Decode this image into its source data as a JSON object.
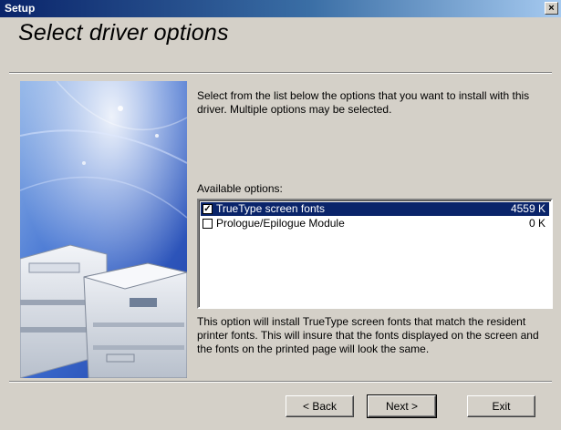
{
  "window": {
    "title": "Setup",
    "close_glyph": "×"
  },
  "page": {
    "heading": "Select driver options",
    "description": "Select from the list below the options that you want to install with this driver. Multiple options may be selected."
  },
  "options": {
    "label": "Available options:",
    "items": [
      {
        "name": "TrueType screen fonts",
        "size": "4559 K",
        "checked": true,
        "selected": true
      },
      {
        "name": "Prologue/Epilogue Module",
        "size": "0 K",
        "checked": false,
        "selected": false
      }
    ],
    "info": "This option will install TrueType screen fonts that match the resident printer fonts. This will insure that the fonts displayed on the screen and the fonts on the printed page will look the same."
  },
  "buttons": {
    "back": "< Back",
    "next": "Next >",
    "exit": "Exit"
  },
  "colors": {
    "titlebar_start": "#0a246a",
    "selection": "#0a246a",
    "dialog_bg": "#d4d0c8"
  }
}
